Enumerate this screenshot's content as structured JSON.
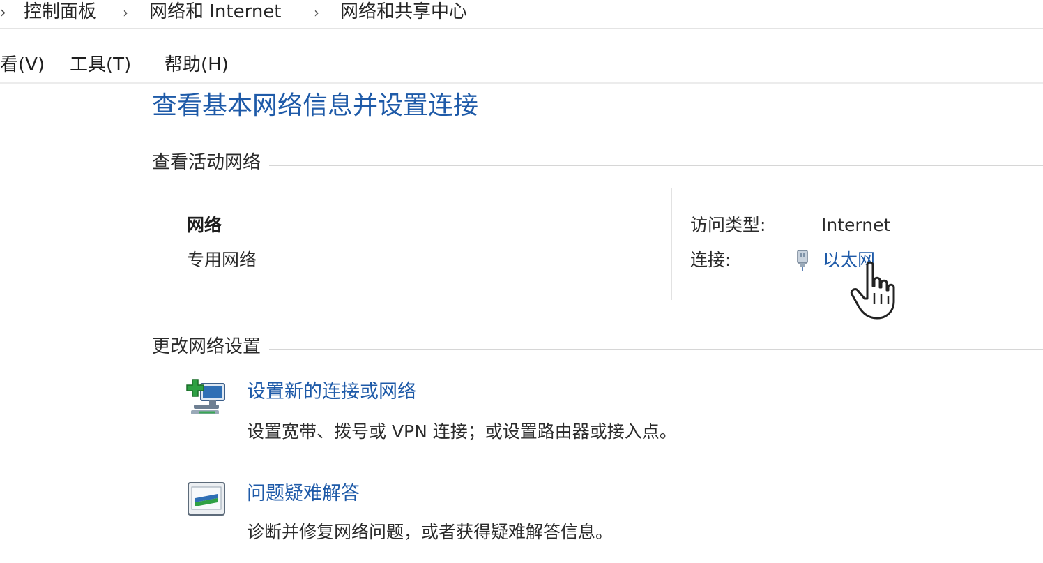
{
  "breadcrumb": {
    "items": [
      "控制面板",
      "网络和 Internet",
      "网络和共享中心"
    ],
    "separator": "›"
  },
  "menubar": {
    "items": [
      "看(V)",
      "工具(T)",
      "帮助(H)"
    ]
  },
  "main": {
    "title": "查看基本网络信息并设置连接",
    "active_section": {
      "header": "查看活动网络",
      "network_name": "网络",
      "network_type": "专用网络",
      "access_label": "访问类型:",
      "access_value": "Internet",
      "connection_label": "连接:",
      "connection_value": "以太网"
    },
    "change_section": {
      "header": "更改网络设置",
      "tasks": [
        {
          "title": "设置新的连接或网络",
          "description": "设置宽带、拨号或 VPN 连接；或设置路由器或接入点。",
          "icon": "network-setup-icon"
        },
        {
          "title": "问题疑难解答",
          "description": "诊断并修复网络问题，或者获得疑难解答信息。",
          "icon": "troubleshoot-icon"
        }
      ]
    }
  },
  "colors": {
    "link": "#1e5aa8",
    "text": "#1e1e1e",
    "divider": "#d6d6d6"
  }
}
